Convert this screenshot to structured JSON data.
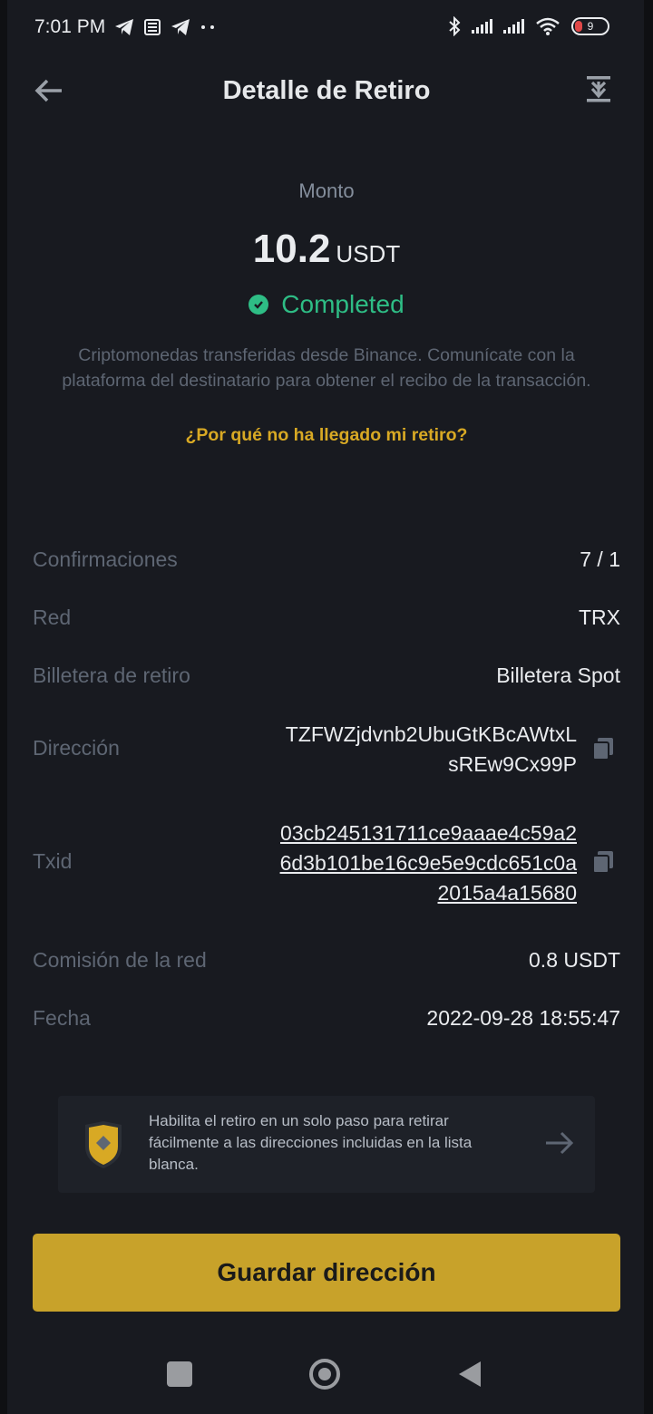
{
  "status_bar": {
    "time": "7:01 PM",
    "battery": "9"
  },
  "header": {
    "title": "Detalle de Retiro"
  },
  "amount": {
    "label": "Monto",
    "value": "10.2",
    "unit": "USDT",
    "status": "Completed",
    "status_color": "#2ebd85",
    "info": "Criptomonedas transferidas desde Binance. Comunícate con la plataforma del destinatario para obtener el recibo de la transacción.",
    "help_link": "¿Por qué no ha llegado mi retiro?"
  },
  "details": {
    "confirmations_label": "Confirmaciones",
    "confirmations_value": "7 / 1",
    "network_label": "Red",
    "network_value": "TRX",
    "wallet_label": "Billetera de retiro",
    "wallet_value": "Billetera Spot",
    "address_label": "Dirección",
    "address_line1": "TZFWZjdvnb2UbuGtKBcAWtxL",
    "address_line2": "sREw9Cx99P",
    "txid_label": "Txid",
    "txid_line1": "03cb245131711ce9aaae4c59a2",
    "txid_line2": "6d3b101be16c9e5e9cdc651c0a",
    "txid_line3": "2015a4a15680",
    "fee_label": "Comisión de la red",
    "fee_value": "0.8 USDT",
    "date_label": "Fecha",
    "date_value": "2022-09-28 18:55:47"
  },
  "banner": {
    "text": "Habilita el retiro en un solo paso para retirar fácilmente a las direcciones incluidas en la lista blanca."
  },
  "actions": {
    "save_address": "Guardar dirección"
  },
  "colors": {
    "accent": "#c8a22a",
    "link": "#d8a924",
    "background": "#181a20"
  }
}
